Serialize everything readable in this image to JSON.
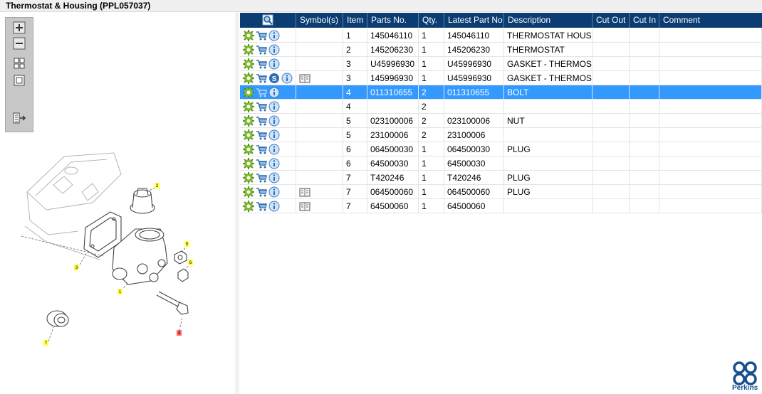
{
  "window": {
    "title": "Thermostat & Housing (PPL057037)"
  },
  "toolbar": {
    "buttons": [
      {
        "name": "zoom-in-button",
        "icon": "zoom-in-icon"
      },
      {
        "name": "zoom-out-button",
        "icon": "zoom-out-icon"
      },
      {
        "name": "fit-view-button",
        "icon": "fit-view-icon"
      },
      {
        "name": "actual-size-button",
        "icon": "actual-size-icon"
      },
      {
        "name": "list-sync-button",
        "icon": "list-sync-icon"
      }
    ]
  },
  "diagram": {
    "callouts": [
      "2",
      "3",
      "1",
      "5",
      "6",
      "4",
      "7"
    ],
    "callout_color": "#ffff44",
    "highlight_color": "#ff6666"
  },
  "grid": {
    "columns": [
      "",
      "Symbol(s)",
      "Item",
      "Parts No.",
      "Qty.",
      "Latest Part No.",
      "Description",
      "Cut Out",
      "Cut In",
      "Comment"
    ],
    "header_icon": "find-icon",
    "header_color": "#0b3d73",
    "selected_color": "#3399ff",
    "rows": [
      {
        "icons": [
          "gear-icon",
          "cart-icon",
          "info-icon"
        ],
        "symbol": "",
        "item": "1",
        "part_no": "145046110",
        "qty": "1",
        "latest": "145046110",
        "desc": "THERMOSTAT HOUSING",
        "selected": false
      },
      {
        "icons": [
          "gear-icon",
          "cart-icon",
          "info-icon"
        ],
        "symbol": "",
        "item": "2",
        "part_no": "145206230",
        "qty": "1",
        "latest": "145206230",
        "desc": "THERMOSTAT",
        "selected": false
      },
      {
        "icons": [
          "gear-icon",
          "cart-icon",
          "info-icon"
        ],
        "symbol": "",
        "item": "3",
        "part_no": "U45996930",
        "qty": "1",
        "latest": "U45996930",
        "desc": "GASKET - THERMOSTAT",
        "selected": false
      },
      {
        "icons": [
          "gear-icon",
          "cart-icon",
          "supersession-icon",
          "info-icon"
        ],
        "symbol": "book-icon",
        "item": "3",
        "part_no": "145996930",
        "qty": "1",
        "latest": "U45996930",
        "desc": "GASKET - THERMOSTAT",
        "selected": false
      },
      {
        "icons": [
          "gear-icon",
          "cart-disabled-icon",
          "info-icon"
        ],
        "symbol": "",
        "item": "4",
        "part_no": "011310655",
        "qty": "2",
        "latest": "011310655",
        "desc": "BOLT",
        "selected": true
      },
      {
        "icons": [
          "gear-icon",
          "cart-icon",
          "info-icon"
        ],
        "symbol": "",
        "item": "4",
        "part_no": "",
        "qty": "2",
        "latest": "",
        "desc": "",
        "selected": false
      },
      {
        "icons": [
          "gear-icon",
          "cart-icon",
          "info-icon"
        ],
        "symbol": "",
        "item": "5",
        "part_no": "023100006",
        "qty": "2",
        "latest": "023100006",
        "desc": "NUT",
        "selected": false
      },
      {
        "icons": [
          "gear-icon",
          "cart-icon",
          "info-icon"
        ],
        "symbol": "",
        "item": "5",
        "part_no": "23100006",
        "qty": "2",
        "latest": "23100006",
        "desc": "",
        "selected": false
      },
      {
        "icons": [
          "gear-icon",
          "cart-icon",
          "info-icon"
        ],
        "symbol": "",
        "item": "6",
        "part_no": "064500030",
        "qty": "1",
        "latest": "064500030",
        "desc": "PLUG",
        "selected": false
      },
      {
        "icons": [
          "gear-icon",
          "cart-icon",
          "info-icon"
        ],
        "symbol": "",
        "item": "6",
        "part_no": "64500030",
        "qty": "1",
        "latest": "64500030",
        "desc": "",
        "selected": false
      },
      {
        "icons": [
          "gear-icon",
          "cart-icon",
          "info-icon"
        ],
        "symbol": "",
        "item": "7",
        "part_no": "T420246",
        "qty": "1",
        "latest": "T420246",
        "desc": "PLUG",
        "selected": false
      },
      {
        "icons": [
          "gear-icon",
          "cart-icon",
          "info-icon"
        ],
        "symbol": "book-icon",
        "item": "7",
        "part_no": "064500060",
        "qty": "1",
        "latest": "064500060",
        "desc": "PLUG",
        "selected": false
      },
      {
        "icons": [
          "gear-icon",
          "cart-icon",
          "info-icon"
        ],
        "symbol": "book-icon",
        "item": "7",
        "part_no": "64500060",
        "qty": "1",
        "latest": "64500060",
        "desc": "",
        "selected": false
      }
    ]
  },
  "brand": {
    "logo_text": "Perkins",
    "color": "#1a4f8f"
  }
}
